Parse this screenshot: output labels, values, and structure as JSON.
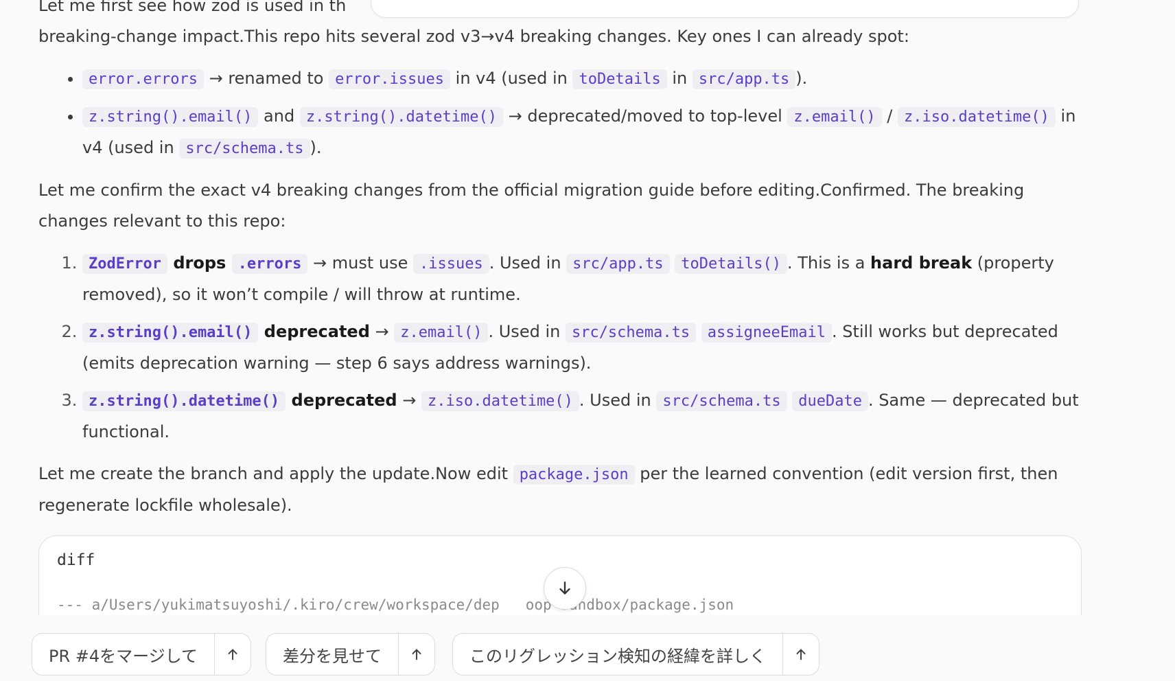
{
  "chat": {
    "p1_a": "Let me first see how zod is used in th",
    "p1_b": "breaking-change impact.This repo hits several zod v3→v4 breaking changes. Key ones I can already spot:",
    "bullets": [
      {
        "c1": "error.errors",
        "t1": " → renamed to ",
        "c2": "error.issues",
        "t2": " in v4 (used in ",
        "c3": "toDetails",
        "t3": " in ",
        "c4": "src/app.ts",
        "t4": ")."
      },
      {
        "c1": "z.string().email()",
        "t1": " and ",
        "c2": "z.string().datetime()",
        "t2": " → deprecated/moved to top-level ",
        "c3": "z.email()",
        "t3": " / ",
        "c4": "z.iso.datetime()",
        "t4": " in v4 (used in ",
        "c5": "src/schema.ts",
        "t5": ")."
      }
    ],
    "p2": "Let me confirm the exact v4 breaking changes from the official migration guide before editing.Confirmed. The breaking changes relevant to this repo:",
    "numbered": [
      {
        "b1": "ZodError",
        "b2": " drops ",
        "b3": ".errors",
        "t1": " → must use ",
        "c1": ".issues",
        "t2": ". Used in ",
        "c2": "src/app.ts",
        "c3": "toDetails()",
        "t3": ". This is a ",
        "b4": "hard break",
        "t4": " (property removed), so it won’t compile / will throw at runtime."
      },
      {
        "b1": "z.string().email()",
        "b2": " deprecated",
        "t1": " → ",
        "c1": "z.email()",
        "t2": ". Used in ",
        "c2": "src/schema.ts",
        "c3": "assigneeEmail",
        "t3": ". Still works but deprecated (emits deprecation warning — step 6 says address warnings)."
      },
      {
        "b1": "z.string().datetime()",
        "b2": " deprecated",
        "t1": " → ",
        "c1": "z.iso.datetime()",
        "t2": ". Used in ",
        "c2": "src/schema.ts",
        "c3": "dueDate",
        "t3": ". Same — deprecated but functional."
      }
    ],
    "p3_a": "Let me create the branch and apply the update.Now edit ",
    "p3_code": "package.json",
    "p3_b": " per the learned convention (edit version first, then regenerate lockfile wholesale)."
  },
  "code_block": {
    "lang": "diff",
    "line1": "--- a/Users/yukimatsuyoshi/.kiro/crew/workspace/dep   oop-sandbox/package.json"
  },
  "scroll_button": {
    "icon": "arrow-down-icon"
  },
  "suggestions": [
    {
      "label": "PR #4をマージして"
    },
    {
      "label": "差分を見せて"
    },
    {
      "label": "このリグレッション検知の経緯を詳しく"
    }
  ]
}
